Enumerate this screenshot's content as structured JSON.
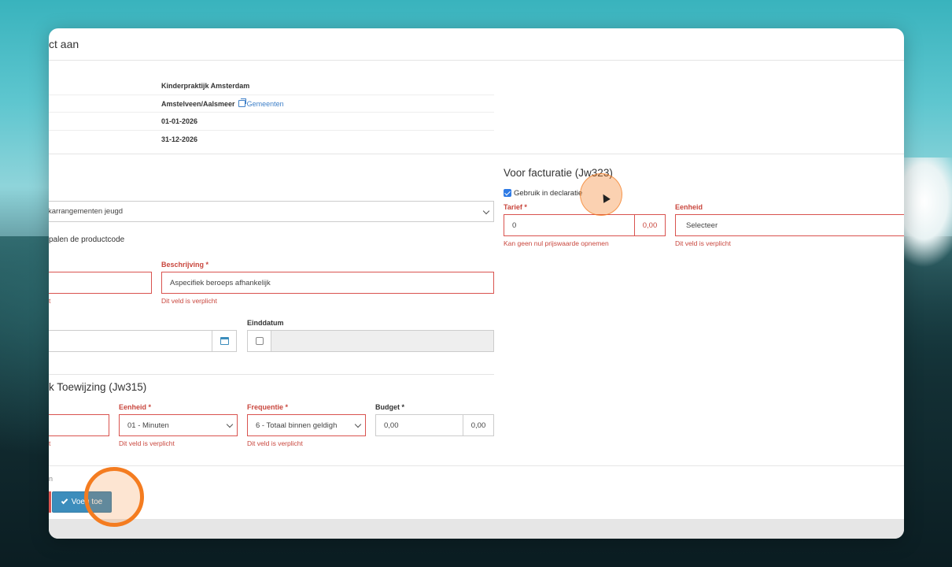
{
  "modal": {
    "title": "ct aan"
  },
  "info": {
    "provider": "Kinderpraktijk Amsterdam",
    "region": "Amstelveen/Aalsmeer",
    "region_link": "Gemeenten",
    "start_date": "01-01-2026",
    "end_date": "31-12-2026"
  },
  "product": {
    "category_value": "karrangementen jeugd",
    "productcode_text": "palen de productcode",
    "beschrijving_label": "Beschrijving *",
    "beschrijving_value": "Aspecifiek beroeps afhankelijk",
    "beschrijving_error": "Dit veld is verplicht",
    "left_field_error_fragment": "t",
    "einddatum_label": "Einddatum"
  },
  "toewijzing": {
    "title": "k Toewijzing (Jw315)",
    "eenheid_label": "Eenheid *",
    "eenheid_value": "01 - Minuten",
    "eenheid_error": "Dit veld is verplicht",
    "frequentie_label": "Frequentie *",
    "frequentie_value": "6 - Totaal binnen geldigh",
    "frequentie_error": "Dit veld is verplicht",
    "budget_label": "Budget *",
    "budget_value": "0,00",
    "budget_addon": "0,00",
    "left_field_error_fragment": "t"
  },
  "facturatie": {
    "title": "Voor facturatie (Jw323)",
    "checkbox_label": "Gebruik in declaratie",
    "checkbox_checked": true,
    "tarief_label": "Tarief *",
    "tarief_value": "0",
    "tarief_addon": "0,00",
    "tarief_error": "Kan geen nul prijswaarde opnemen",
    "eenheid_label": "Eenheid",
    "eenheid_value": "Selecteer",
    "eenheid_error": "Dit veld is verplicht"
  },
  "footer": {
    "fragment": "n",
    "add_button": "Voeg toe"
  },
  "colors": {
    "error": "#c9473e",
    "primary": "#3c8dbc",
    "highlight": "#f47c20"
  }
}
